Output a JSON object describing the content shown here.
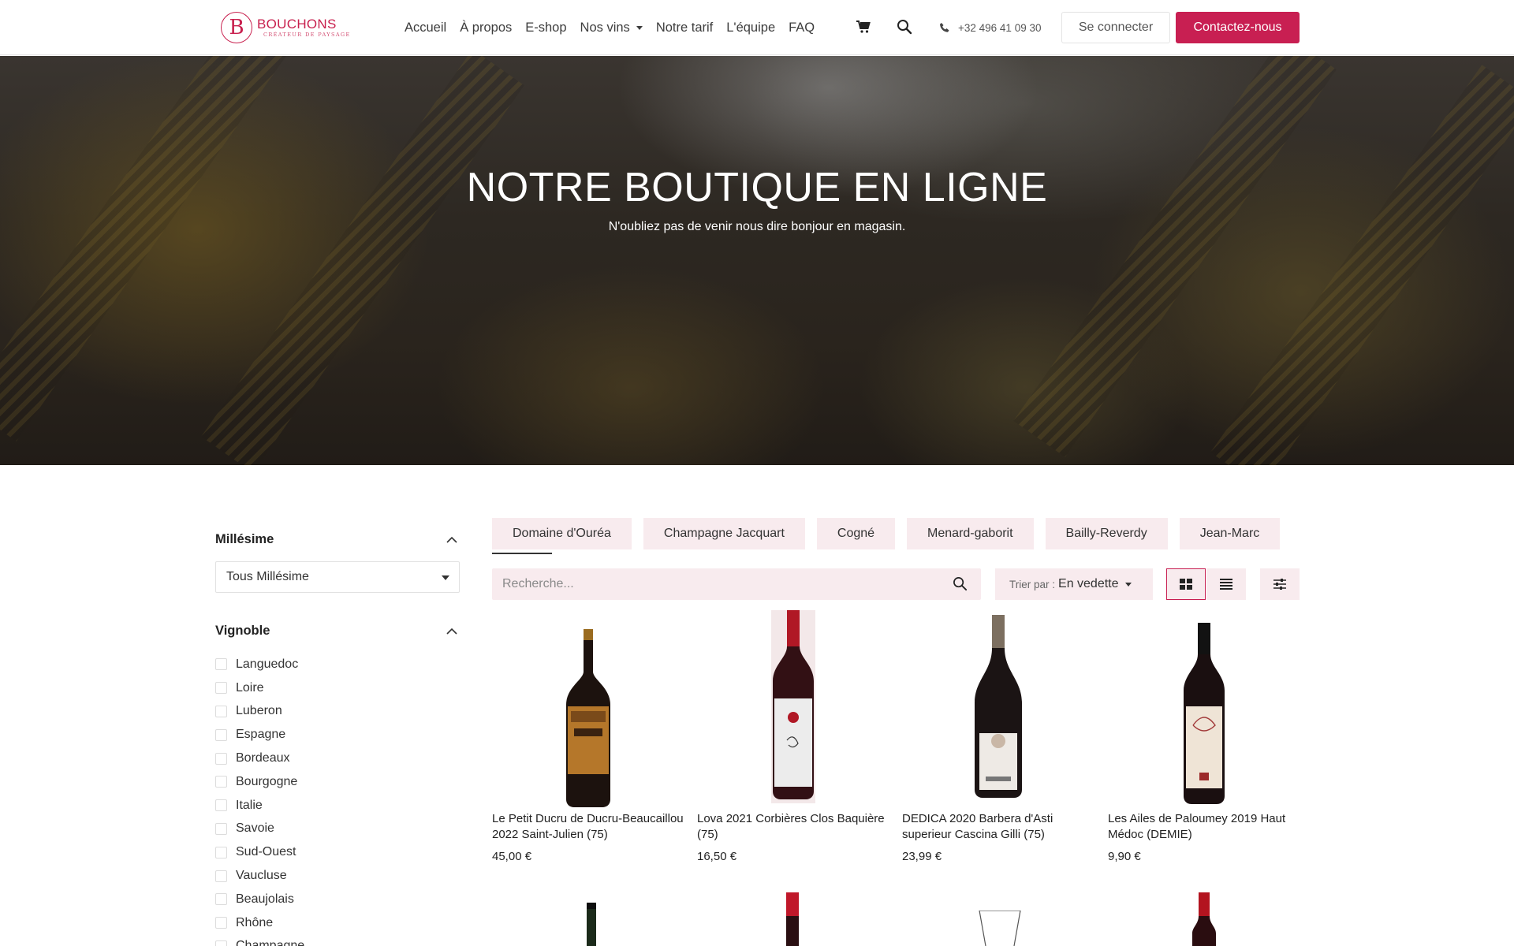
{
  "brand": {
    "name": "BOUCHONS",
    "tagline": "CRÉATEUR DE PAYSAGE",
    "accent_color": "#c81f52"
  },
  "nav": {
    "items": [
      {
        "label": "Accueil"
      },
      {
        "label": "À propos"
      },
      {
        "label": "E-shop"
      },
      {
        "label": "Nos vins"
      },
      {
        "label": "Notre tarif"
      },
      {
        "label": "L'équipe"
      },
      {
        "label": "FAQ"
      }
    ],
    "cart_icon": "cart-icon",
    "search_icon": "search-icon",
    "phone": "+32 496 41 09 30",
    "login_label": "Se connecter",
    "contact_label": "Contactez-nous"
  },
  "hero": {
    "title": "NOTRE BOUTIQUE EN LIGNE",
    "subtitle": "N'oubliez pas de venir nous dire bonjour en magasin."
  },
  "filters": {
    "millesime": {
      "title": "Millésime",
      "selected": "Tous Millésime"
    },
    "vignoble": {
      "title": "Vignoble",
      "options": [
        "Languedoc",
        "Loire",
        "Luberon",
        "Espagne",
        "Bordeaux",
        "Bourgogne",
        "Italie",
        "Savoie",
        "Sud-Ouest",
        "Vaucluse",
        "Beaujolais",
        "Rhône",
        "Champagne"
      ]
    }
  },
  "tabs": [
    "Domaine d'Ouréa",
    "Champagne Jacquart",
    "Cogné",
    "Menard-gaborit",
    "Bailly-Reverdy",
    "Jean-Marc"
  ],
  "toolbar": {
    "search_placeholder": "Recherche...",
    "sort_label": "Trier par :",
    "sort_value": "En vedette"
  },
  "products": [
    {
      "name": "Le Petit Ducru de Ducru-Beaucaillou 2022 Saint-Julien (75)",
      "price": "45,00 €"
    },
    {
      "name": "Lova 2021 Corbières Clos Baquière (75)",
      "price": "16,50 €"
    },
    {
      "name": "DEDICA 2020 Barbera d'Asti superieur Cascina Gilli (75)",
      "price": "23,99 €"
    },
    {
      "name": "Les Ailes de Paloumey 2019 Haut Médoc (DEMIE)",
      "price": "9,90 €"
    }
  ]
}
